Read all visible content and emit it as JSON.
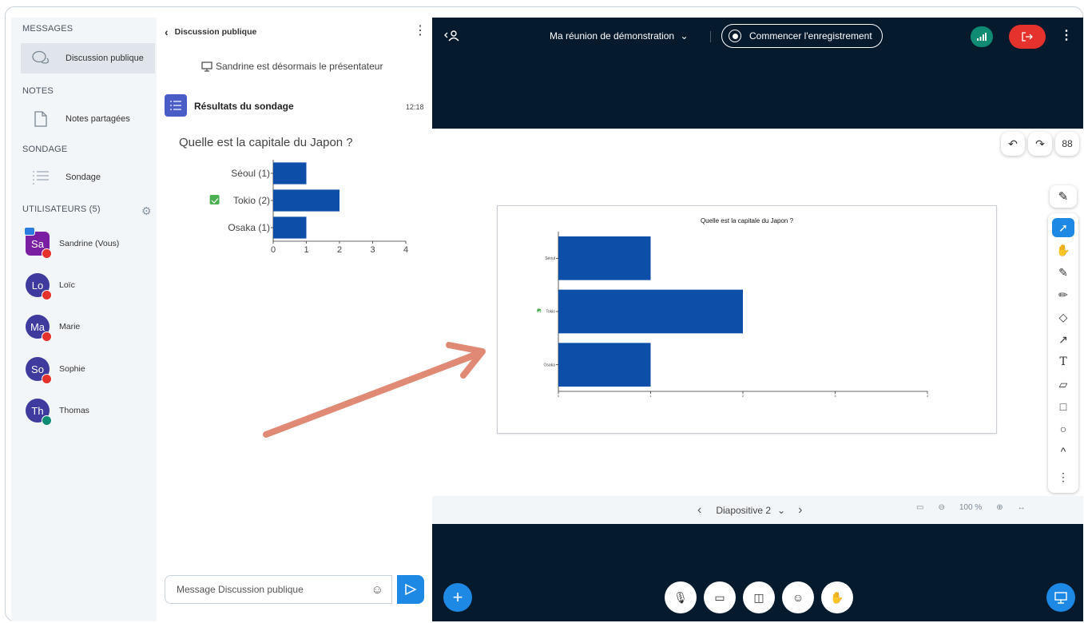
{
  "sidebar": {
    "messages_title": "MESSAGES",
    "public_chat_label": "Discussion publique",
    "notes_title": "NOTES",
    "shared_notes_label": "Notes partagées",
    "poll_title": "SONDAGE",
    "poll_label": "Sondage",
    "users_title": "UTILISATEURS (5)",
    "users": [
      {
        "initials": "Sa",
        "name": "Sandrine (Vous)",
        "color": "#7b1fa2"
      },
      {
        "initials": "Lo",
        "name": "Loïc",
        "color": "#3f3a9e"
      },
      {
        "initials": "Ma",
        "name": "Marie",
        "color": "#3f3a9e"
      },
      {
        "initials": "So",
        "name": "Sophie",
        "color": "#3f3a9e"
      },
      {
        "initials": "Th",
        "name": "Thomas",
        "color": "#3f3a9e"
      }
    ]
  },
  "chat": {
    "header": "Discussion publique",
    "system_message": "Sandrine est désormais le présentateur",
    "poll_result_title": "Résultats du sondage",
    "poll_time": "12:18",
    "question": "Quelle est la capitale du Japon ?",
    "input_placeholder": "Message Discussion publique"
  },
  "chart_data": [
    {
      "type": "bar",
      "orientation": "horizontal",
      "categories": [
        "Séoul (1)",
        "Tokio (2)",
        "Osaka (1)"
      ],
      "values": [
        1,
        2,
        1
      ],
      "xlim": [
        0,
        4
      ],
      "xticks": [
        "0",
        "1",
        "2",
        "3",
        "4"
      ],
      "correct_category": "Tokio (2)",
      "bar_color": "#0d4fa8"
    },
    {
      "type": "bar",
      "orientation": "horizontal",
      "title": "Quelle est la capitale du Japon ?",
      "categories": [
        "Séoul",
        "Tokio",
        "Osaka"
      ],
      "values": [
        1,
        2,
        1
      ],
      "xlim": [
        0,
        4
      ],
      "xticks": [
        "0",
        "1",
        "2",
        "3",
        "4"
      ],
      "correct_category": "Tokio",
      "bar_color": "#0d4fa8"
    }
  ],
  "topbar": {
    "meeting_title": "Ma réunion de démonstration",
    "record_label": "Commencer l'enregistrement"
  },
  "slidebar": {
    "slide_label": "Diapositive 2",
    "zoom": "100 %"
  },
  "colors": {
    "accent": "#1e88e5",
    "dark": "#061a2e",
    "danger": "#e5322d",
    "success": "#0f8a73",
    "arrow": "#e08a75"
  }
}
